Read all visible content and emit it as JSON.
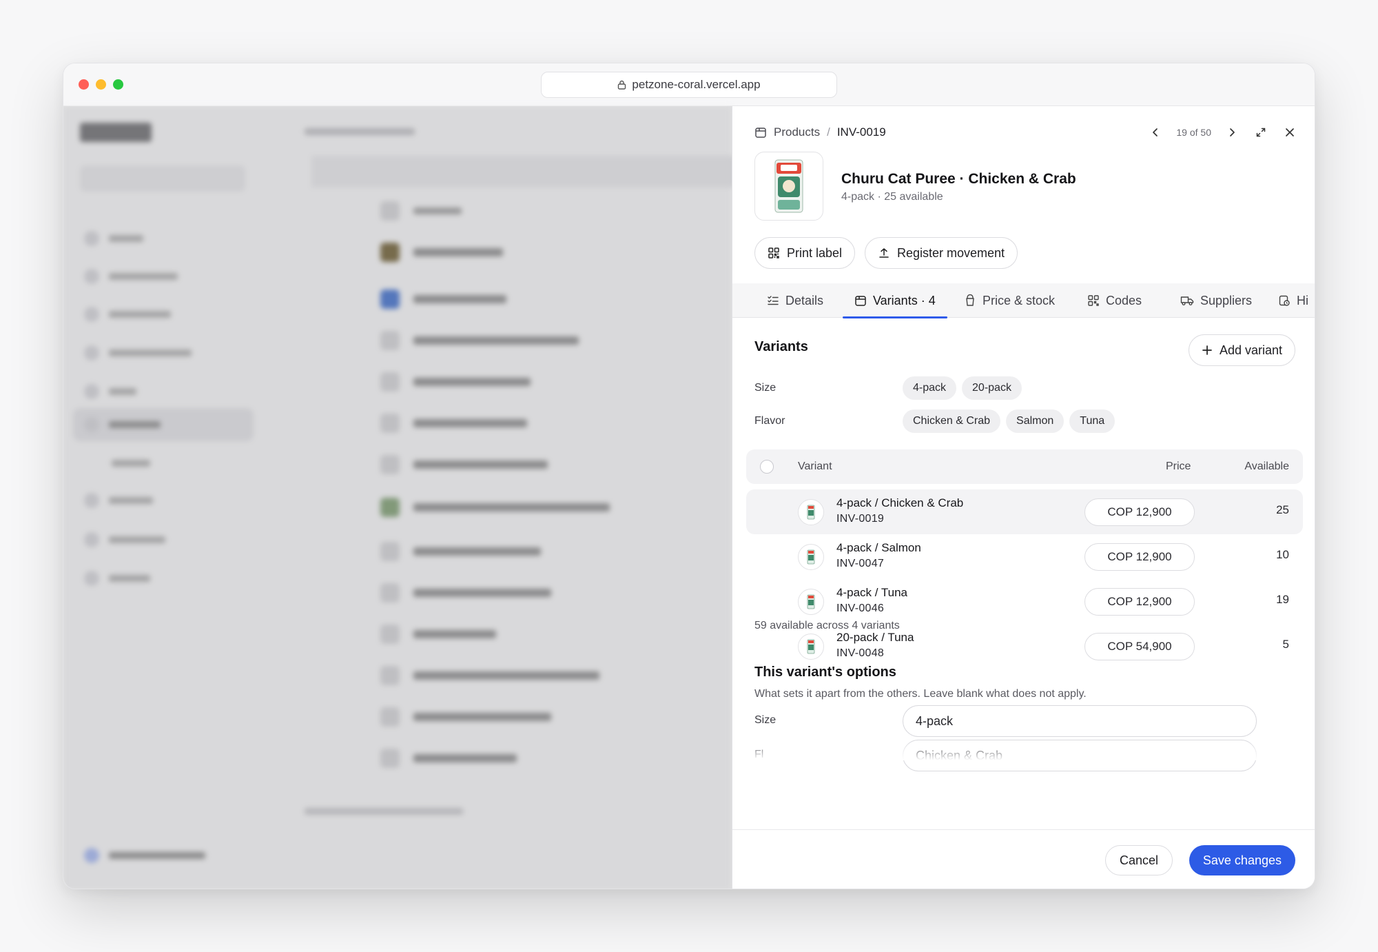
{
  "browser": {
    "url": "petzone-coral.vercel.app"
  },
  "breadcrumb": {
    "root": "Products",
    "sep": "/",
    "current": "INV-0019"
  },
  "pager": {
    "text": "19 of 50"
  },
  "product": {
    "title": "Churu Cat Puree · Chicken & Crab",
    "subtitle": "4-pack · 25 available"
  },
  "actions": {
    "print_label": "Print label",
    "register_movement": "Register movement"
  },
  "tabs": [
    {
      "label": "Details"
    },
    {
      "label": "Variants · 4"
    },
    {
      "label": "Price & stock"
    },
    {
      "label": "Codes"
    },
    {
      "label": "Suppliers"
    },
    {
      "label": "Hi"
    }
  ],
  "variants_section": {
    "title": "Variants",
    "add_label": "Add variant",
    "size_label": "Size",
    "size_options": [
      "4-pack",
      "20-pack"
    ],
    "flavor_label": "Flavor",
    "flavor_options": [
      "Chicken & Crab",
      "Salmon",
      "Tuna"
    ],
    "table_headers": {
      "variant": "Variant",
      "price": "Price",
      "available": "Available"
    },
    "rows": [
      {
        "name": "4-pack / Chicken & Crab",
        "sku": "INV-0019",
        "price": "COP 12,900",
        "available": "25"
      },
      {
        "name": "4-pack / Salmon",
        "sku": "INV-0047",
        "price": "COP 12,900",
        "available": "10"
      },
      {
        "name": "4-pack / Tuna",
        "sku": "INV-0046",
        "price": "COP 12,900",
        "available": "19"
      },
      {
        "name": "20-pack / Tuna",
        "sku": "INV-0048",
        "price": "COP 54,900",
        "available": "5"
      }
    ],
    "summary": "59 available across 4 variants"
  },
  "options_section": {
    "title": "This variant's options",
    "description": "What sets it apart from the others. Leave blank what does not apply.",
    "size_label": "Size",
    "size_value": "4-pack",
    "flavor_label": "Fl",
    "flavor_value": "Chicken & Crab"
  },
  "footer": {
    "cancel": "Cancel",
    "save": "Save changes"
  },
  "colors": {
    "accent": "#2d5be6"
  }
}
